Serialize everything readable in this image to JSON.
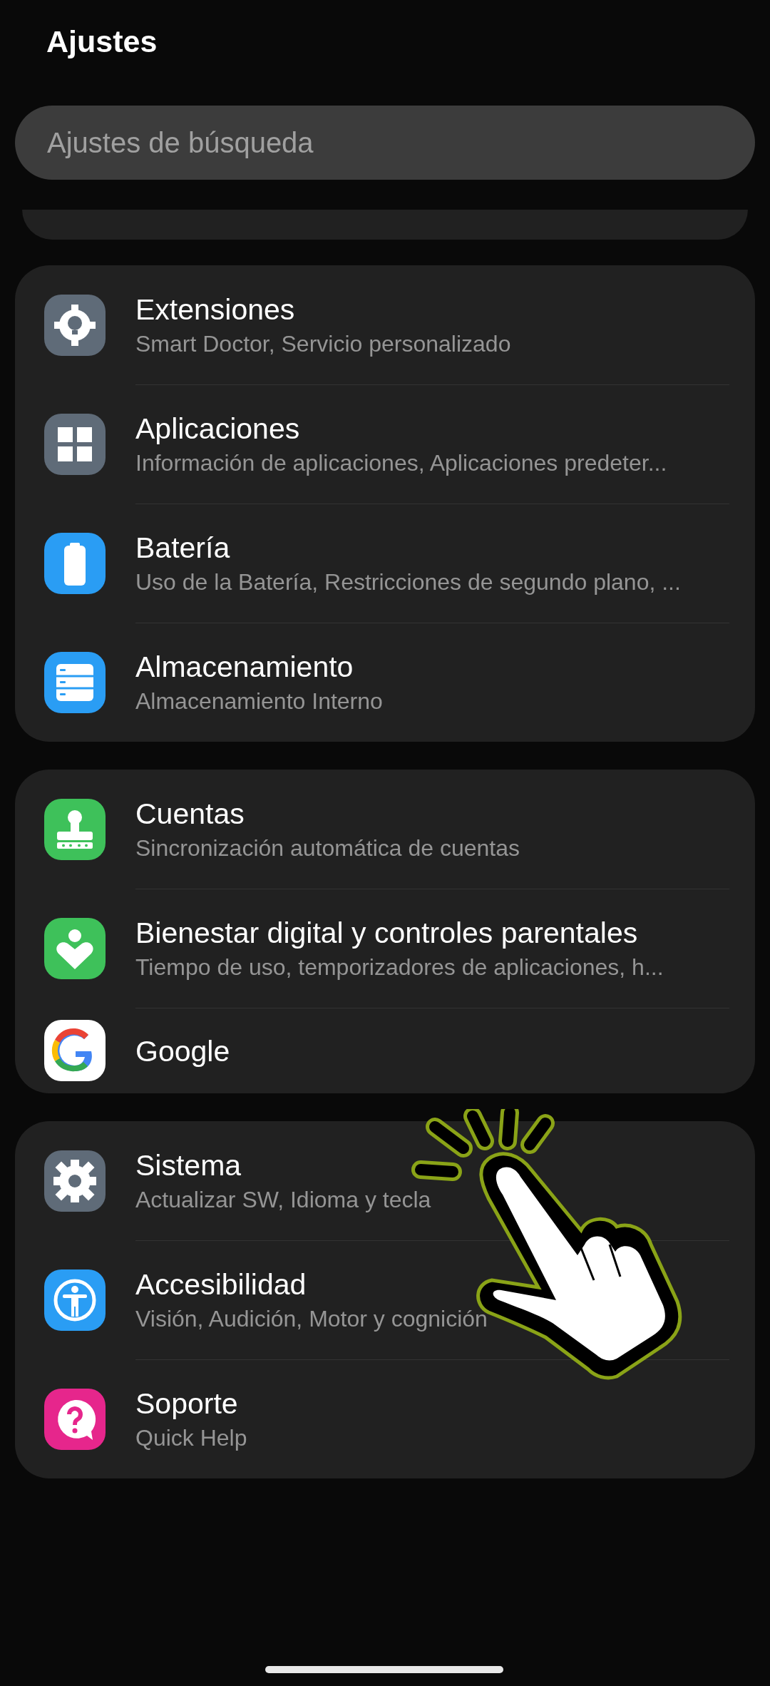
{
  "header": {
    "title": "Ajustes"
  },
  "search": {
    "placeholder": "Ajustes de búsqueda"
  },
  "groups": [
    {
      "items": [
        {
          "kind": "bulb-gear",
          "title": "Extensiones",
          "subtitle": "Smart Doctor, Servicio personalizado"
        },
        {
          "kind": "grid",
          "title": "Aplicaciones",
          "subtitle": "Información de aplicaciones, Aplicaciones predeter..."
        },
        {
          "kind": "battery",
          "title": "Batería",
          "subtitle": "Uso de la Batería, Restricciones de segundo plano, ..."
        },
        {
          "kind": "storage",
          "title": "Almacenamiento",
          "subtitle": "Almacenamiento Interno"
        }
      ]
    },
    {
      "items": [
        {
          "kind": "account",
          "title": "Cuentas",
          "subtitle": "Sincronización automática de cuentas"
        },
        {
          "kind": "wellbeing",
          "title": "Bienestar digital y controles parentales",
          "subtitle": "Tiempo de uso, temporizadores de aplicaciones, h..."
        },
        {
          "kind": "google",
          "title": "Google"
        }
      ]
    },
    {
      "items": [
        {
          "kind": "gear",
          "title": "Sistema",
          "subtitle": "Actualizar SW, Idioma y tecla"
        },
        {
          "kind": "accessibility",
          "title": "Accesibilidad",
          "subtitle": "Visión, Audición, Motor y cognición"
        },
        {
          "kind": "help",
          "title": "Soporte",
          "subtitle": "Quick Help"
        }
      ]
    }
  ]
}
